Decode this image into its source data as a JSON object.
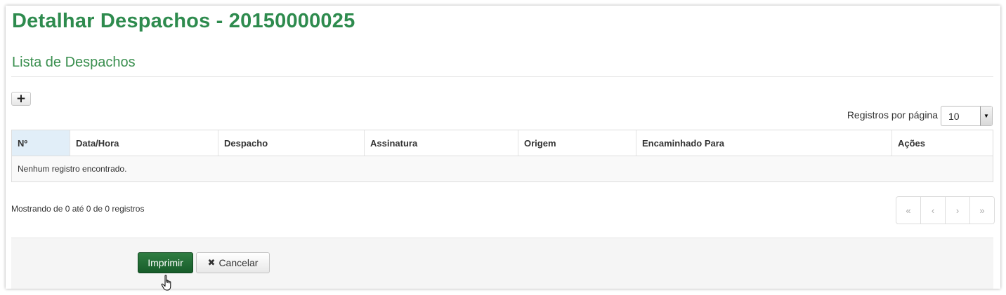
{
  "header": {
    "title": "Detalhar Despachos - 20150000025"
  },
  "section": {
    "title": "Lista de Despachos",
    "add_icon": "plus-icon"
  },
  "table_controls": {
    "per_page_label": "Registros por página",
    "per_page_value": "10"
  },
  "table": {
    "columns": [
      "Nº",
      "Data/Hora",
      "Despacho",
      "Assinatura",
      "Origem",
      "Encaminhado Para",
      "Ações"
    ],
    "empty_message": "Nenhum registro encontrado."
  },
  "pagination": {
    "info": "Mostrando de 0 até 0 de 0 registros",
    "first": "«",
    "prev": "‹",
    "next": "›",
    "last": "»"
  },
  "footer": {
    "print_label": "Imprimir",
    "cancel_label": "Cancelar",
    "cancel_icon": "close-icon"
  },
  "colors": {
    "title_green": "#2e8b4e",
    "primary_button": "#1e6b33",
    "sorted_header": "#e1eef8"
  }
}
